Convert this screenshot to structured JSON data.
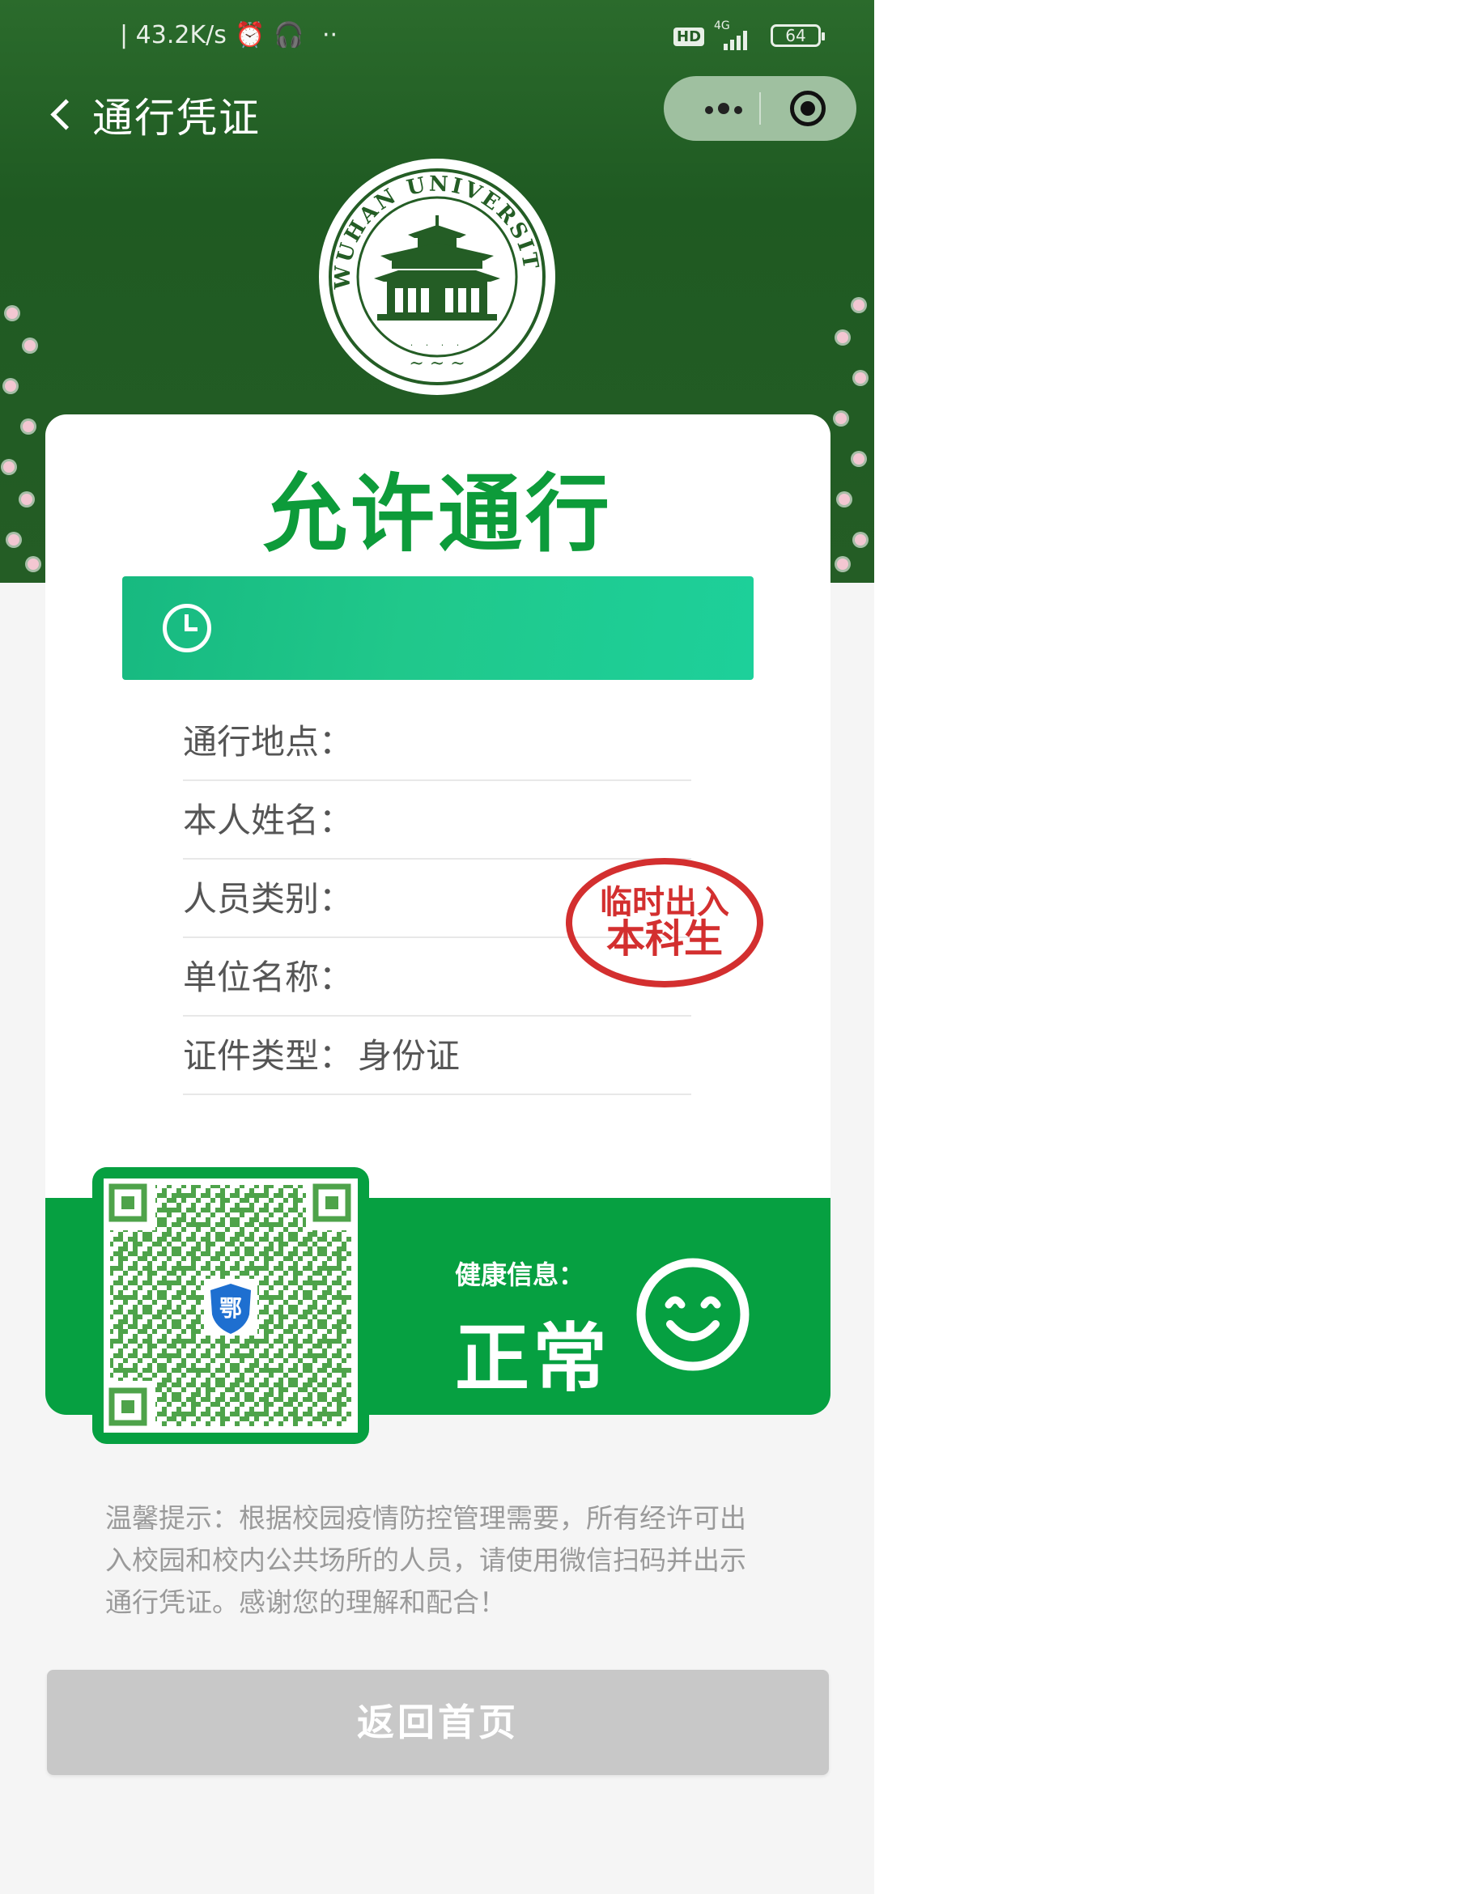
{
  "status_bar": {
    "speed": "| 43.2K/s",
    "hd": "HD",
    "network": "4G",
    "battery": "64"
  },
  "navbar": {
    "title": "通行凭证"
  },
  "card": {
    "pass_title": "允许通行",
    "time_text": "",
    "info_rows": [
      {
        "label": "通行地点：",
        "value": ""
      },
      {
        "label": "本人姓名：",
        "value": ""
      },
      {
        "label": "人员类别：",
        "value": ""
      },
      {
        "label": "单位名称：",
        "value": ""
      },
      {
        "label": "证件类型：",
        "value": "身份证"
      }
    ],
    "stamp": {
      "line1": "临时出入",
      "line2": "本科生"
    },
    "health": {
      "label": "健康信息：",
      "status": "正常"
    },
    "qr_badge": "鄂"
  },
  "notice": "温馨提示：根据校园疫情防控管理需要，所有经许可出入校园和校内公共场所的人员，请使用微信扫码并出示通行凭证。感谢您的理解和配合！",
  "home_button": "返回首页",
  "colors": {
    "header_green": "#245d25",
    "pass_green": "#0d9b3a",
    "health_green": "#06a041",
    "time_bar": "#1dc88e",
    "stamp_red": "#d32f2f",
    "button_gray": "#c8c8c8"
  }
}
